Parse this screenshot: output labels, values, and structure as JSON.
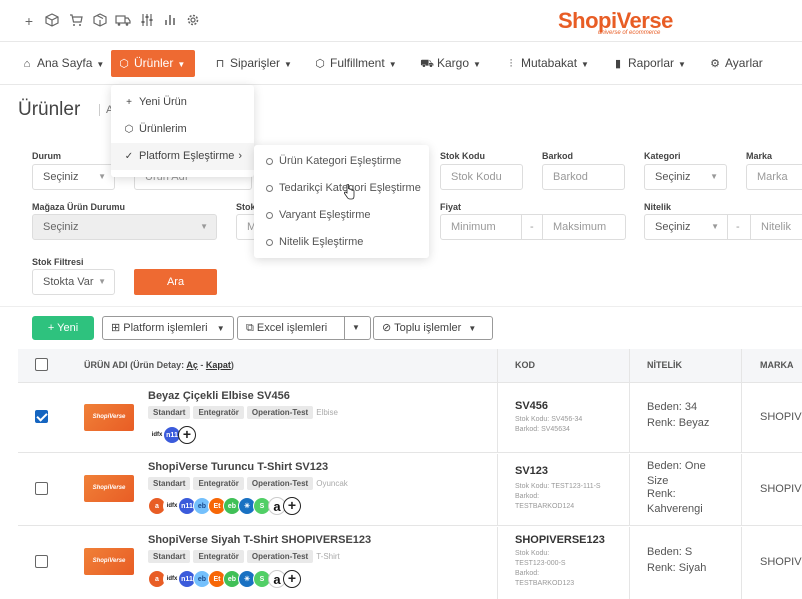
{
  "topbar": {
    "icons": [
      "plus-icon",
      "box-icon",
      "cart-icon",
      "cube-icon",
      "truck-icon",
      "sliders-icon",
      "bar-chart-icon",
      "gear-icon"
    ],
    "logo": "ShopiVerse",
    "logo_sub": "universe of ecommerce"
  },
  "nav": {
    "items": [
      {
        "label": "Ana Sayfa",
        "icon": "home-icon"
      },
      {
        "label": "Ürünler",
        "icon": "box-icon"
      },
      {
        "label": "Siparişler",
        "icon": "cart-icon"
      },
      {
        "label": "Fulfillment",
        "icon": "cube-icon"
      },
      {
        "label": "Kargo",
        "icon": "truck-icon"
      },
      {
        "label": "Mutabakat",
        "icon": "sliders-icon"
      },
      {
        "label": "Raporlar",
        "icon": "bar-chart-icon"
      },
      {
        "label": "Ayarlar",
        "icon": "gear-icon"
      }
    ]
  },
  "menu": {
    "items": [
      {
        "label": "Yeni Ürün",
        "icon": "plus-icon"
      },
      {
        "label": "Ürünlerim",
        "icon": "box-icon"
      },
      {
        "label": "Platform Eşleştirme",
        "icon": "check-circle-icon"
      }
    ],
    "submenu": [
      {
        "label": "Ürün Kategori Eşleştirme"
      },
      {
        "label": "Tedarikçi Kategori Eşleştirme"
      },
      {
        "label": "Varyant Eşleştirme"
      },
      {
        "label": "Nitelik Eşleştirme"
      }
    ]
  },
  "page": {
    "title": "Ürünler",
    "crumb": "An"
  },
  "filters": {
    "durum": {
      "label": "Durum",
      "value": "Seçiniz"
    },
    "urun_adi": {
      "placeholder": "Ürün Adı"
    },
    "stok_kodu": {
      "label": "Stok Kodu",
      "placeholder": "Stok Kodu"
    },
    "barkod": {
      "label": "Barkod",
      "placeholder": "Barkod"
    },
    "kategori": {
      "label": "Kategori",
      "value": "Seçiniz"
    },
    "marka": {
      "label": "Marka",
      "placeholder": "Marka"
    },
    "magaza": {
      "label": "Mağaza Ürün Durumu",
      "value": "Seçiniz"
    },
    "stok": {
      "label": "Stok",
      "placeholder": "M"
    },
    "fiyat": {
      "label": "Fiyat",
      "min": "Minimum",
      "dash": "-",
      "max": "Maksimum"
    },
    "nitelik": {
      "label": "Nitelik",
      "value": "Seçiniz",
      "dash": "-",
      "placeholder": "Nitelik"
    },
    "stok_filtresi": {
      "label": "Stok Filtresi",
      "value": "Stokta Var"
    },
    "search_button": "Ara"
  },
  "actions": {
    "new": "+ Yeni",
    "platform": "Platform işlemleri",
    "excel": "Excel işlemleri",
    "bulk": "Toplu işlemler"
  },
  "table": {
    "headers": {
      "name_prefix": "ÜRÜN ADI (Ürün Detay:",
      "open": "Aç",
      "sep": "-",
      "close": "Kapat",
      "suffix": ")",
      "code": "KOD",
      "attr": "NİTELİK",
      "brand": "MARKA"
    },
    "rows": [
      {
        "checked": true,
        "thumb": "ShopiVerse",
        "name": "Beyaz Çiçekli Elbise SV456",
        "tags": [
          "Standart",
          "Entegratör",
          "Operation-Test"
        ],
        "category": "Elbise",
        "code": "SV456",
        "stock_code": "Stok Kodu: SV456-34",
        "barcode": "Barkod: SV45634",
        "attr1": "Beden: 34",
        "attr2": "Renk: Beyaz",
        "brand": "SHOPIVE",
        "markets": [
          "idefix",
          "n11",
          "plus"
        ]
      },
      {
        "checked": false,
        "thumb": "ShopiVerse",
        "name": "ShopiVerse Turuncu T-Shirt SV123",
        "tags": [
          "Standart",
          "Entegratör",
          "Operation-Test"
        ],
        "category": "Oyuncak",
        "code": "SV123",
        "stock_code": "Stok Kodu: TEST123-111-S",
        "barcode": "Barkod: TESTBARKOD124",
        "attr1": "Beden: One Size",
        "attr2": "Renk: Kahverengi",
        "brand": "SHOPIVE",
        "markets": [
          "a",
          "idefix",
          "n11",
          "ebay",
          "etsy",
          "ebay2",
          "walmart",
          "shopify",
          "amazon",
          "plus"
        ]
      },
      {
        "checked": false,
        "thumb": "ShopiVerse",
        "name": "ShopiVerse Siyah T-Shirt SHOPIVERSE123",
        "tags": [
          "Standart",
          "Entegratör",
          "Operation-Test"
        ],
        "category": "T-Shirt",
        "code": "SHOPIVERSE123",
        "stock_code": "Stok Kodu: TEST123-000-S",
        "barcode": "Barkod: TESTBARKOD123",
        "attr1": "Beden: S",
        "attr2": "Renk: Siyah",
        "brand": "SHOPIVE",
        "markets": [
          "a",
          "idefix",
          "n11",
          "ebay",
          "etsy",
          "ebay2",
          "walmart",
          "shopify",
          "amazon",
          "plus"
        ]
      }
    ]
  },
  "colors": {
    "accent": "#ee6a32",
    "green": "#2ec27e",
    "check": "#1565c0"
  }
}
